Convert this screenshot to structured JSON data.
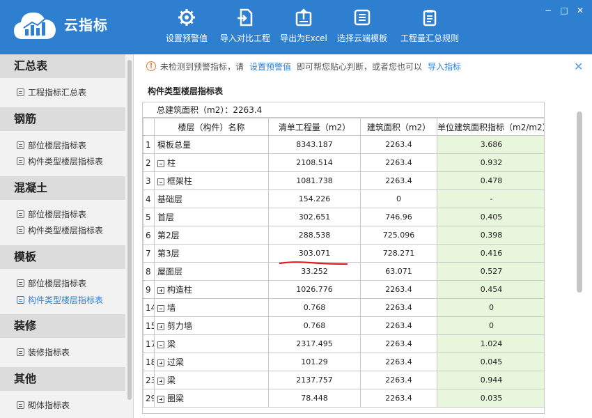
{
  "app": {
    "name": "云指标"
  },
  "toolbar": [
    {
      "label": "设置预警值",
      "icon": "gear-icon"
    },
    {
      "label": "导入对比工程",
      "icon": "import-icon"
    },
    {
      "label": "导出为Excel",
      "icon": "export-icon"
    },
    {
      "label": "选择云端模板",
      "icon": "template-icon"
    },
    {
      "label": "工程量汇总规则",
      "icon": "clipboard-icon"
    }
  ],
  "window": {
    "minimize": "−",
    "maximize": "□",
    "close": "✕"
  },
  "sidebar": {
    "sections": [
      {
        "title": "汇总表",
        "items": [
          "工程指标汇总表"
        ]
      },
      {
        "title": "钢筋",
        "items": [
          "部位楼层指标表",
          "构件类型楼层指标表"
        ]
      },
      {
        "title": "混凝土",
        "items": [
          "部位楼层指标表",
          "构件类型楼层指标表"
        ]
      },
      {
        "title": "模板",
        "items": [
          "部位楼层指标表",
          "构件类型楼层指标表"
        ]
      },
      {
        "title": "装修",
        "items": [
          "装修指标表"
        ]
      },
      {
        "title": "其他",
        "items": [
          "砌体指标表"
        ]
      }
    ],
    "active": "模板/构件类型楼层指标表"
  },
  "notice": {
    "text1": "未检测到预警指标，请",
    "link1": "设置预警值",
    "text2": "即可帮您贴心判断，或者您也可以",
    "link2": "导入指标"
  },
  "section_title": "构件类型楼层指标表",
  "table": {
    "summary": "总建筑面积（m2）：2263.4",
    "headers": [
      "楼层（构件）名称",
      "清单工程量（m2）",
      "建筑面积（m2）",
      "单位建筑面积指标（m2/m2）"
    ],
    "rows": [
      {
        "idx": "1",
        "name": "模板总量",
        "qty": "8343.187",
        "area": "2263.4",
        "index": "3.686"
      },
      {
        "idx": "2",
        "name": "柱",
        "qty": "2108.514",
        "area": "2263.4",
        "index": "0.932"
      },
      {
        "idx": "3",
        "name": "框架柱",
        "qty": "1081.738",
        "area": "2263.4",
        "index": "0.478"
      },
      {
        "idx": "4",
        "name": "基础层",
        "qty": "154.226",
        "area": "0",
        "index": "-"
      },
      {
        "idx": "5",
        "name": "首层",
        "qty": "302.651",
        "area": "746.96",
        "index": "0.405"
      },
      {
        "idx": "6",
        "name": "第2层",
        "qty": "288.538",
        "area": "725.096",
        "index": "0.398"
      },
      {
        "idx": "7",
        "name": "第3层",
        "qty": "303.071",
        "area": "728.271",
        "index": "0.416"
      },
      {
        "idx": "8",
        "name": "屋面层",
        "qty": "33.252",
        "area": "63.071",
        "index": "0.527"
      },
      {
        "idx": "9",
        "name": "构造柱",
        "qty": "1026.776",
        "area": "2263.4",
        "index": "0.454"
      },
      {
        "idx": "14",
        "name": "墙",
        "qty": "0.768",
        "area": "2263.4",
        "index": "0"
      },
      {
        "idx": "15",
        "name": "剪力墙",
        "qty": "0.768",
        "area": "2263.4",
        "index": "0"
      },
      {
        "idx": "17",
        "name": "梁",
        "qty": "2317.495",
        "area": "2263.4",
        "index": "1.024"
      },
      {
        "idx": "18",
        "name": "过梁",
        "qty": "101.29",
        "area": "2263.4",
        "index": "0.045"
      },
      {
        "idx": "23",
        "name": "梁",
        "qty": "2137.757",
        "area": "2263.4",
        "index": "0.944"
      },
      {
        "idx": "29",
        "name": "圈梁",
        "qty": "78.448",
        "area": "2263.4",
        "index": "0.035"
      }
    ]
  },
  "colors": {
    "header_bg": "#2f7fd0",
    "accent": "#2f7fd0",
    "index_cell_bg": "#e8f6dc",
    "annotation": "#e01b24",
    "warn": "#e8772e"
  }
}
